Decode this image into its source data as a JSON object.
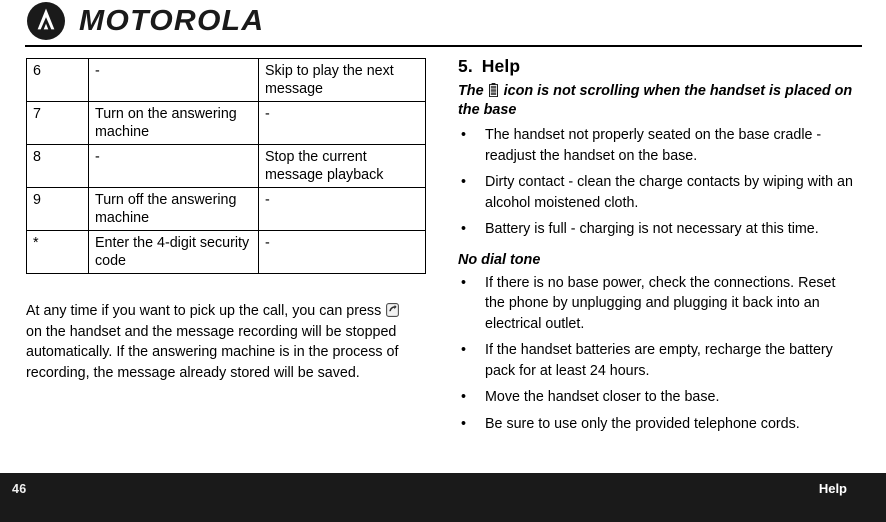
{
  "header": {
    "brand": "MOTOROLA",
    "logo_icon": "motorola-batwing-logo"
  },
  "left_column": {
    "table": {
      "columns": [
        "key",
        "base_action",
        "handset_action"
      ],
      "rows": [
        {
          "key": "6",
          "base_action": "-",
          "handset_action": "Skip to play the next message"
        },
        {
          "key": "7",
          "base_action": "Turn on the answering machine",
          "handset_action": "-"
        },
        {
          "key": "8",
          "base_action": "-",
          "handset_action": "Stop the current message playback"
        },
        {
          "key": "9",
          "base_action": "Turn off the answering machine",
          "handset_action": "-"
        },
        {
          "key": "*",
          "base_action": "Enter the 4-digit security code",
          "handset_action": "-"
        }
      ]
    },
    "paragraph": {
      "part1": "At any time if you want to pick up the call, you can press",
      "icon": "talk-key-icon",
      "part2": "on the handset and the message recording will be stopped automatically. If the answering machine is in the process of recording, the message already stored will be saved."
    }
  },
  "right_column": {
    "heading": {
      "number": "5.",
      "title": "Help"
    },
    "battery_subheading": {
      "part1": "The",
      "icon": "battery-icon",
      "part2": "icon is not scrolling when the handset is placed on the base"
    },
    "battery_bullets": [
      "The handset not properly seated on the base cradle - readjust the handset on the base.",
      "Dirty contact - clean the charge contacts by wiping with an alcohol moistened cloth.",
      "Battery is full - charging is not necessary at this time."
    ],
    "no_dial_tone_heading": "No dial tone",
    "no_dial_tone_bullets": [
      "If there is no base power, check the connections. Reset the phone by unplugging and plugging it back into an electrical outlet.",
      "If the handset batteries are empty, recharge the battery pack for at least 24 hours.",
      "Move the handset closer to the base.",
      "Be sure to use only the provided telephone cords."
    ],
    "bullet_glyph": "•"
  },
  "footer": {
    "page_number": "46",
    "section_label": "Help",
    "background_color": "#1a1a1a",
    "text_color": "#ffffff"
  }
}
